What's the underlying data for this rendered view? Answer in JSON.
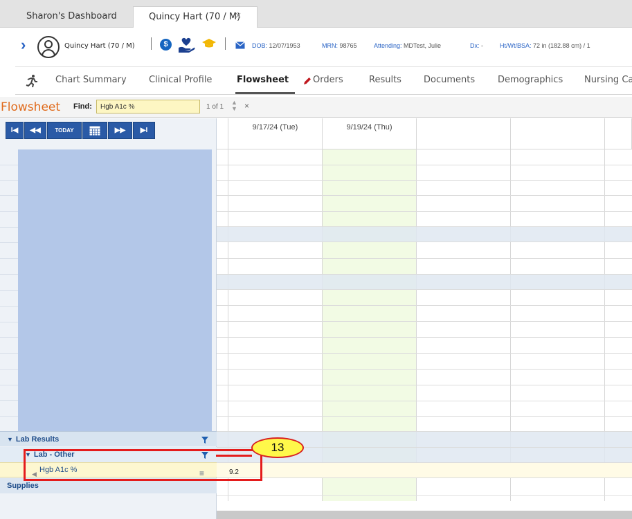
{
  "tabs": [
    {
      "label": "Sharon's Dashboard"
    },
    {
      "label": "Quincy Hart (70 / M)",
      "close": "×"
    }
  ],
  "banner": {
    "patient_name": "Quincy Hart (70 / M)",
    "dob_label": "DOB:",
    "dob": "12/07/1953",
    "mrn_label": "MRN:",
    "mrn": "98765",
    "attending_label": "Attending:",
    "attending": "MDTest, Julie",
    "dx_label": "Dx:",
    "dx": "-",
    "htwt_label": "Ht/Wt/BSA:",
    "htwt": "72 in (182.88 cm) / 1"
  },
  "nav": {
    "items": [
      "Chart Summary",
      "Clinical Profile",
      "Flowsheet",
      "Orders",
      "Results",
      "Documents",
      "Demographics",
      "Nursing Ca"
    ],
    "active": "Flowsheet"
  },
  "flowsheet": {
    "title": "Flowsheet",
    "find_label": "Find:",
    "find_value": "Hgb A1c %",
    "count": "1 of 1",
    "clear": "×",
    "nav_buttons": {
      "first": "I◀",
      "prev": "◀◀",
      "today": "TODAY",
      "next": "▶▶",
      "last": "▶I"
    }
  },
  "grid": {
    "columns": [
      "9/17/24 (Tue)",
      "9/19/24 (Thu)",
      "",
      "",
      ""
    ],
    "groups": {
      "lab_results": "Lab Results",
      "lab_other": "Lab - Other",
      "hgb": "Hgb A1c %",
      "supplies": "Supplies"
    },
    "hgb_value": "9.2"
  },
  "callout": {
    "number": "13"
  },
  "colors": {
    "accent_blue": "#2a5aa6",
    "orange_title": "#e06a1b",
    "callout_red": "#e41c1c",
    "badge_yellow": "#fff84a"
  }
}
